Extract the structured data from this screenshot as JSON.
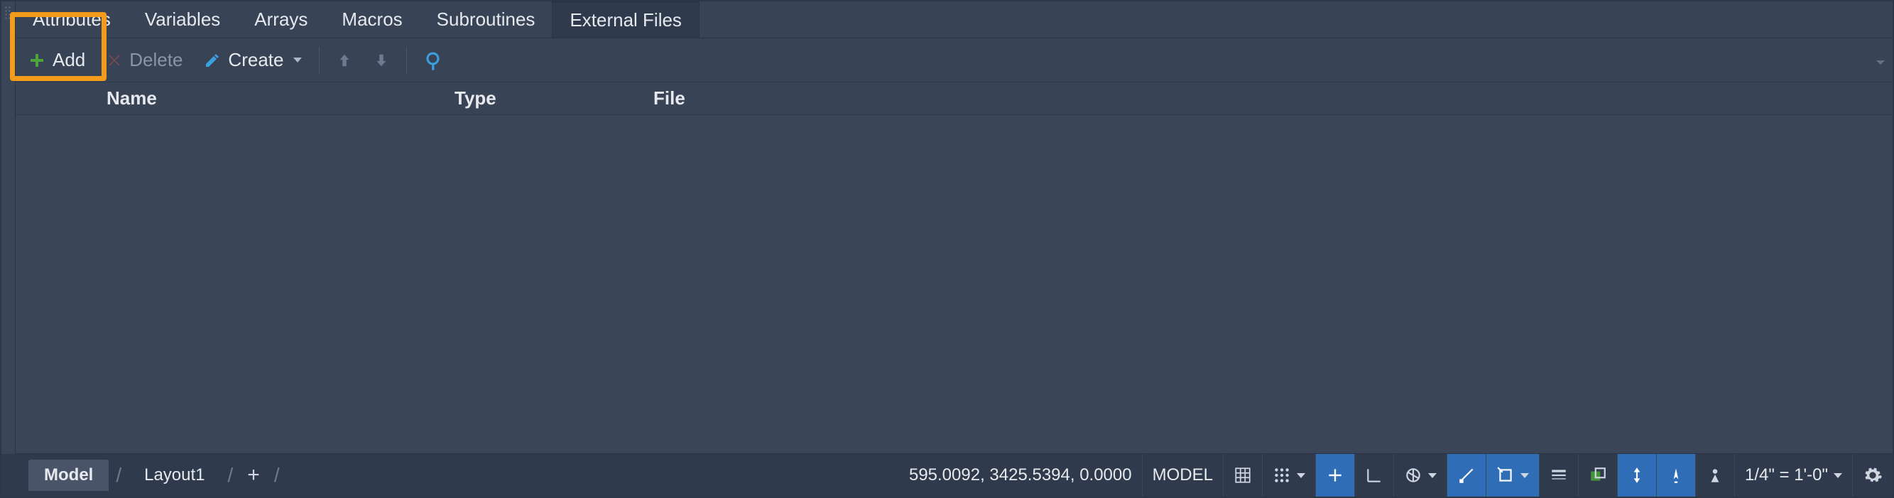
{
  "tabs": {
    "items": [
      {
        "label": "Attributes"
      },
      {
        "label": "Variables"
      },
      {
        "label": "Arrays"
      },
      {
        "label": "Macros"
      },
      {
        "label": "Subroutines"
      },
      {
        "label": "External Files"
      }
    ],
    "active_index": 5
  },
  "toolbar": {
    "add_label": "Add",
    "delete_label": "Delete",
    "create_label": "Create"
  },
  "columns": {
    "name": "Name",
    "type": "Type",
    "file": "File"
  },
  "statusbar": {
    "model_tab": "Model",
    "layout_tab": "Layout1",
    "coords": "595.0092, 3425.5394, 0.0000",
    "space": "MODEL",
    "scale": "1/4\" = 1'-0\""
  },
  "highlight": {
    "target": "add-button"
  }
}
